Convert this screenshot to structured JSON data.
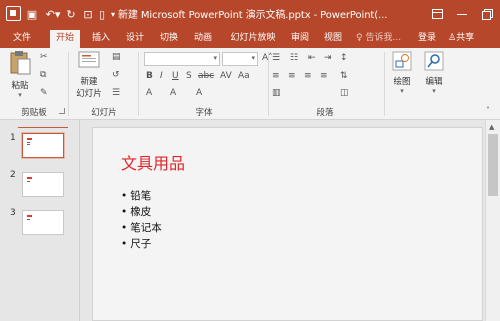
{
  "window": {
    "title": "新建 Microsoft PowerPoint 演示文稿.pptx - PowerPoint(...",
    "accent": "#b7472a"
  },
  "quick_access": {
    "save_icon": "save-icon",
    "undo_icon": "undo-icon",
    "redo_icon": "redo-icon",
    "present_icon": "present-icon",
    "new_icon": "new-file-icon",
    "customize_icon": "customize-icon"
  },
  "tabs": [
    {
      "label": "文件"
    },
    {
      "label": "开始"
    },
    {
      "label": "插入"
    },
    {
      "label": "设计"
    },
    {
      "label": "切换"
    },
    {
      "label": "动画"
    },
    {
      "label": "幻灯片放映"
    },
    {
      "label": "审阅"
    },
    {
      "label": "视图"
    }
  ],
  "tell_me": "告诉我...",
  "login": "登录",
  "share": "共享",
  "ribbon": {
    "groups": [
      {
        "label": "剪贴板"
      },
      {
        "label": "幻灯片"
      },
      {
        "label": "字体"
      },
      {
        "label": "段落"
      }
    ],
    "paste_label": "粘贴",
    "new_slide_label_1": "新建",
    "new_slide_label_2": "幻灯片",
    "draw_label": "绘图",
    "edit_label": "编辑",
    "font_name_value": "",
    "font_size_value": ""
  },
  "thumbnails": [
    {
      "number": "1"
    },
    {
      "number": "2"
    },
    {
      "number": "3"
    }
  ],
  "slide": {
    "title": "文具用品",
    "bullets": [
      "铅笔",
      "橡皮",
      "笔记本",
      "尺子"
    ],
    "title_color": "#e0262a"
  }
}
